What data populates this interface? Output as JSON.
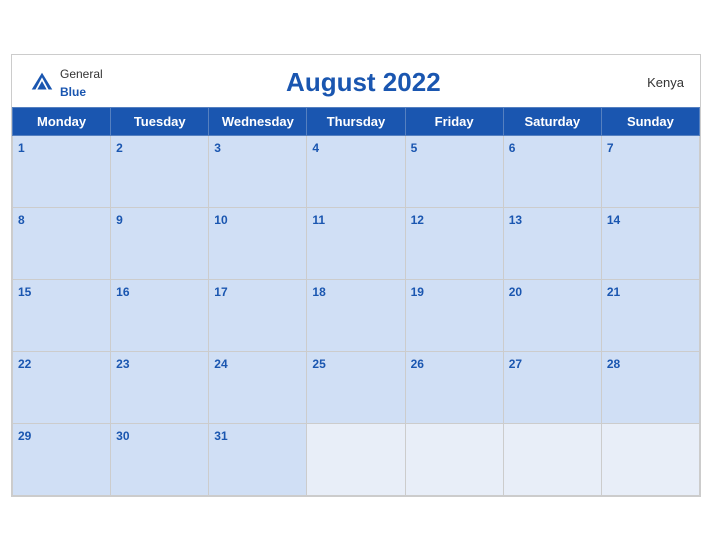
{
  "header": {
    "title": "August 2022",
    "country": "Kenya",
    "logo_general": "General",
    "logo_blue": "Blue"
  },
  "weekdays": [
    "Monday",
    "Tuesday",
    "Wednesday",
    "Thursday",
    "Friday",
    "Saturday",
    "Sunday"
  ],
  "weeks": [
    [
      1,
      2,
      3,
      4,
      5,
      6,
      7
    ],
    [
      8,
      9,
      10,
      11,
      12,
      13,
      14
    ],
    [
      15,
      16,
      17,
      18,
      19,
      20,
      21
    ],
    [
      22,
      23,
      24,
      25,
      26,
      27,
      28
    ],
    [
      29,
      30,
      31,
      null,
      null,
      null,
      null
    ]
  ]
}
